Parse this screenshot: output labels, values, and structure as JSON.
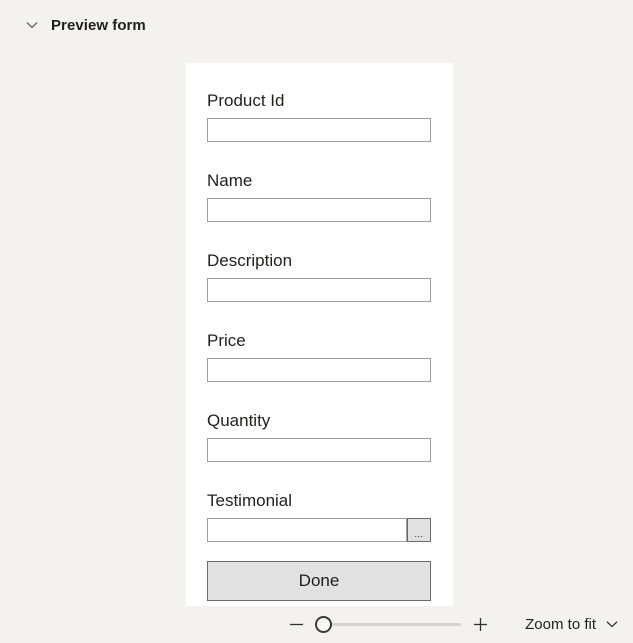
{
  "header": {
    "title": "Preview form",
    "toggle_icon": "chevron-down-icon",
    "expanded": true
  },
  "form": {
    "fields": [
      {
        "label": "Product Id",
        "value": "",
        "placeholder": "",
        "has_ellipsis": false
      },
      {
        "label": "Name",
        "value": "",
        "placeholder": "",
        "has_ellipsis": false
      },
      {
        "label": "Description",
        "value": "",
        "placeholder": "",
        "has_ellipsis": false
      },
      {
        "label": "Price",
        "value": "",
        "placeholder": "",
        "has_ellipsis": false
      },
      {
        "label": "Quantity",
        "value": "",
        "placeholder": "",
        "has_ellipsis": false
      },
      {
        "label": "Testimonial",
        "value": "",
        "placeholder": "",
        "has_ellipsis": true
      }
    ],
    "ellipsis_label": "...",
    "submit_label": "Done"
  },
  "zoom_bar": {
    "zoom_out_icon": "minus-icon",
    "zoom_in_icon": "plus-icon",
    "slider_value": 0,
    "slider_min": 0,
    "slider_max": 100,
    "fit_label": "Zoom to fit",
    "fit_chevron_icon": "chevron-down-icon"
  },
  "colors": {
    "page_background": "#f3f2f1",
    "card_background": "#ffffff",
    "text": "#201f1e",
    "input_border": "#9d9d9d",
    "button_face": "#e1e1e1",
    "button_border": "#6b6b6b",
    "slider_track": "#d6d3d1",
    "slider_thumb_border": "#3b3a39"
  }
}
